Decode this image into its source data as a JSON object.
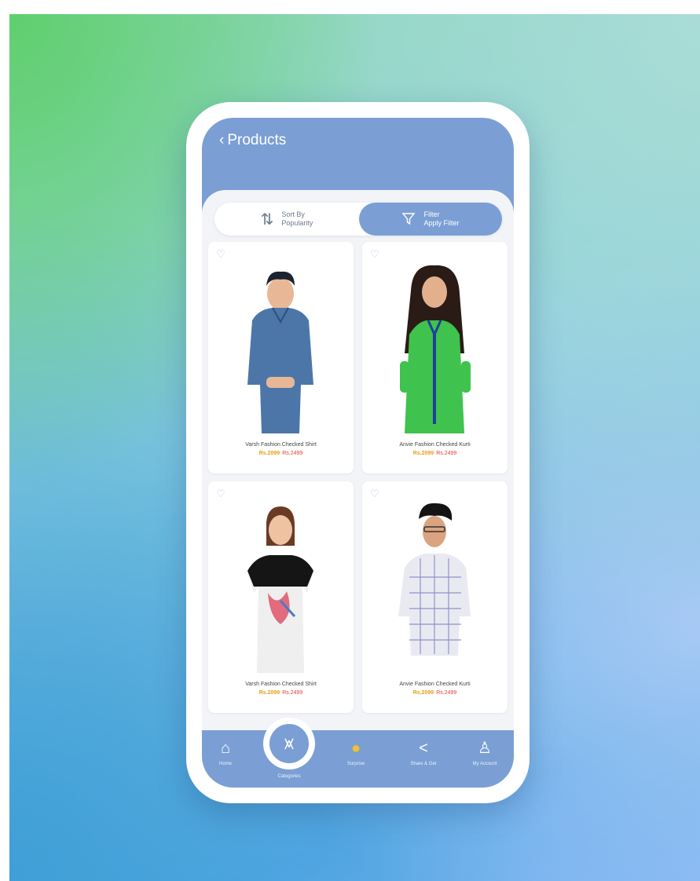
{
  "header": {
    "back_icon": "chevron-left-icon",
    "title": "Products"
  },
  "toolbar": {
    "sort": {
      "icon": "sort-arrows-icon",
      "line1": "Sort By",
      "line2": "Popularity"
    },
    "filter": {
      "icon": "funnel-icon",
      "line1": "Filter",
      "line2": "Apply Filter"
    }
  },
  "products": [
    {
      "name": "Varsh Fashion Checked Shirt",
      "price": "Rs.2099",
      "old_price": "Rs.2499"
    },
    {
      "name": "Anvie Fashion Checked Kurti",
      "price": "Rs.2099",
      "old_price": "Rs.2499"
    },
    {
      "name": "Varsh Fashion Checked Shirt",
      "price": "Rs.2099",
      "old_price": "Rs.2499"
    },
    {
      "name": "Anvie Fashion Checked Kurti",
      "price": "Rs.2099",
      "old_price": "Rs.2499"
    }
  ],
  "nav": {
    "home": {
      "icon": "home-icon",
      "label": "Home"
    },
    "categories": {
      "icon": "categories-icon",
      "label": "Categories"
    },
    "offers": {
      "icon": "emoji-icon",
      "label": "Surprise"
    },
    "share": {
      "icon": "share-icon",
      "label": "Share & Get"
    },
    "account": {
      "icon": "user-icon",
      "label": "My Account"
    }
  },
  "colors": {
    "accent": "#7b9fd4",
    "price": "#e5a019",
    "old_price": "#e0403a"
  }
}
